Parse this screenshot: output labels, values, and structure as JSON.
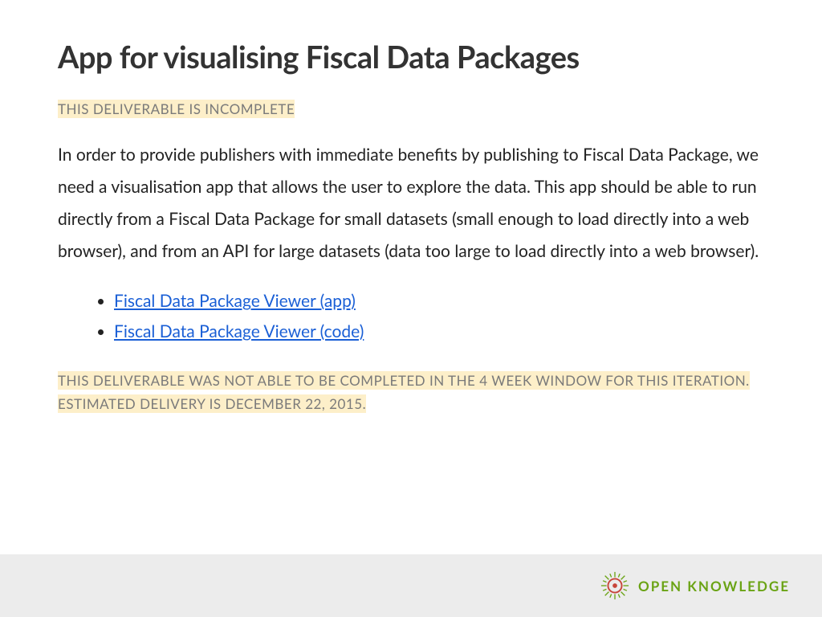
{
  "title": "App for visualising Fiscal Data Packages",
  "notice1": "THIS DELIVERABLE IS INCOMPLETE",
  "paragraph": "In order to provide publishers with immediate benefits by publishing to Fiscal Data Package, we need a visualisation app that allows the user to explore the data. This app should be able to run directly from a Fiscal Data Package for small datasets (small enough to load directly into a web browser), and from an API for large datasets (data too large to load directly into a web browser).",
  "links": [
    "Fiscal Data Package Viewer (app)",
    "Fiscal Data Package Viewer (code)"
  ],
  "notice2": "THIS DELIVERABLE WAS NOT ABLE TO BE COMPLETED IN THE 4 WEEK WINDOW FOR THIS ITERATION. ESTIMATED DELIVERY IS DECEMBER 22, 2015.",
  "footer": {
    "brand": "OPEN KNOWLEDGE"
  }
}
